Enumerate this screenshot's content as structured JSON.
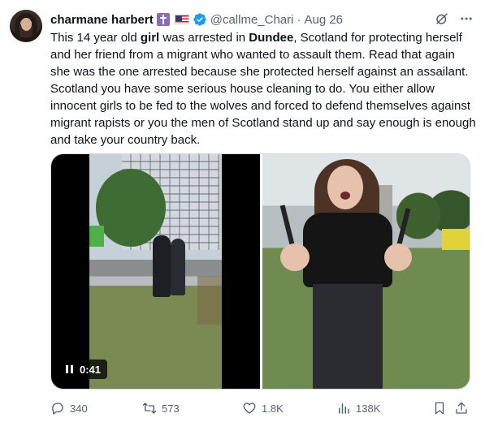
{
  "tweet": {
    "author": {
      "display_name": "charmane harbert",
      "handle": "@callme_Chari",
      "date": "Aug 26"
    },
    "text": {
      "p1": "This 14 year old ",
      "b1": "girl",
      "p2": " was arrested in ",
      "b2": "Dundee",
      "p3": ", Scotland for protecting herself and her friend from a migrant who wanted to assault them. Read that again she was the one arrested because she protected herself against an assailant. Scotland you have some serious house cleaning to do. You either allow innocent girls to be fed to the wolves and forced to defend themselves against migrant rapists or you the men of Scotland stand up and say enough is enough and take your country back."
    },
    "media": {
      "video_time": "0:41"
    },
    "metrics": {
      "replies": "340",
      "reposts": "573",
      "likes": "1.8K",
      "views": "138K"
    }
  },
  "icons": {
    "author_badges": [
      "cross-badge",
      "us-flag",
      "verified-badge"
    ],
    "top": [
      "grok-icon",
      "more-icon"
    ],
    "actions": [
      "reply-icon",
      "repost-icon",
      "like-icon",
      "views-icon",
      "bookmark-icon",
      "share-icon"
    ]
  },
  "colors": {
    "text": "#0f1419",
    "secondary": "#536471",
    "verified": "#1d9bf0"
  }
}
